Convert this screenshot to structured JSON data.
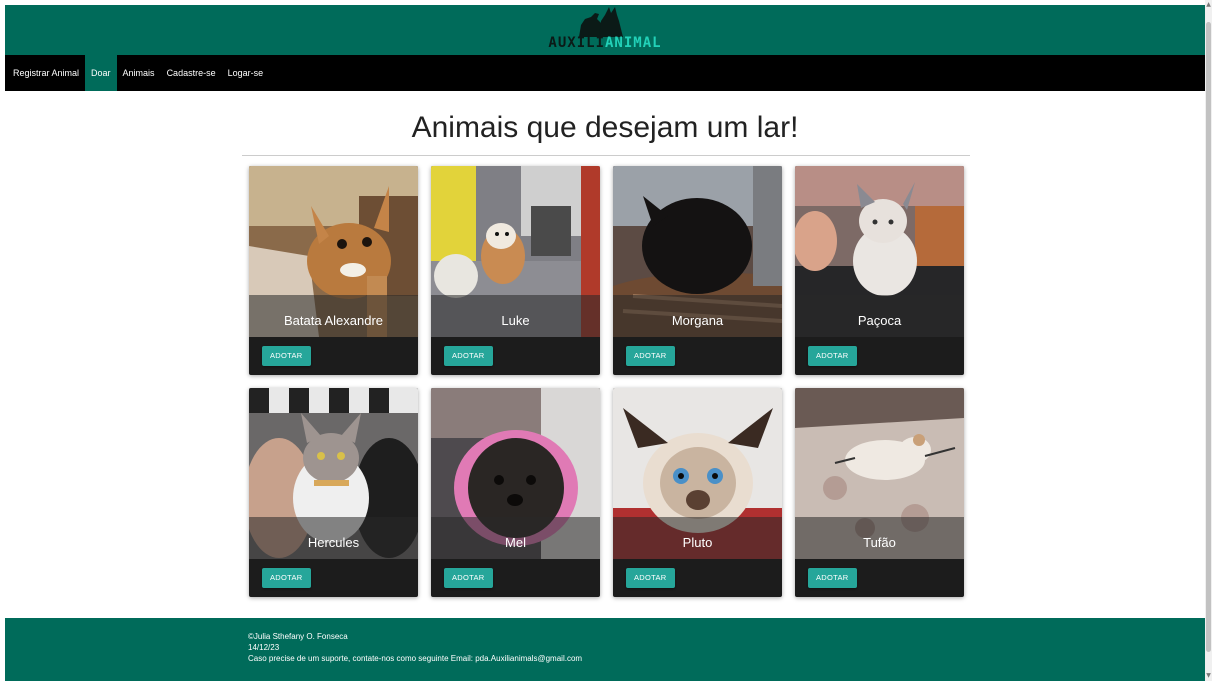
{
  "header": {
    "logo_part1": "AUXILI",
    "logo_part2": "ANIMAL"
  },
  "nav": {
    "items": [
      {
        "label": "Registrar Animal",
        "active": false
      },
      {
        "label": "Doar",
        "active": true
      },
      {
        "label": "Animais",
        "active": false
      },
      {
        "label": "Cadastre-se",
        "active": false
      },
      {
        "label": "Logar-se",
        "active": false
      }
    ]
  },
  "main": {
    "title": "Animais que desejam um lar!",
    "adopt_label": "ADOTAR",
    "animals": [
      {
        "name": "Batata Alexandre",
        "photo": "chihuahua-photo",
        "bg": "#8a6a4a"
      },
      {
        "name": "Luke",
        "photo": "small-dog-on-couch-photo",
        "bg": "#7f7f85"
      },
      {
        "name": "Morgana",
        "photo": "black-cat-photo",
        "bg": "#5c4b44"
      },
      {
        "name": "Paçoca",
        "photo": "kitten-photo",
        "bg": "#7d6a66"
      },
      {
        "name": "Hercules",
        "photo": "tabby-cat-photo",
        "bg": "#6a6868"
      },
      {
        "name": "Mel",
        "photo": "shih-tzu-photo",
        "bg": "#4e4a4e"
      },
      {
        "name": "Pluto",
        "photo": "siamese-cat-photo",
        "bg": "#b03030"
      },
      {
        "name": "Tufão",
        "photo": "puppy-on-rug-photo",
        "bg": "#9a8c86"
      }
    ]
  },
  "footer": {
    "line1": "©Julia Sthefany O. Fonseca",
    "line2": "14/12/23",
    "line3": "Caso precise de um suporte, contate-nos como seguinte Email: pda.Auxilianimals@gmail.com"
  },
  "colors": {
    "brand": "#006b5a",
    "accent": "#26a69a",
    "navbar": "#000000"
  }
}
